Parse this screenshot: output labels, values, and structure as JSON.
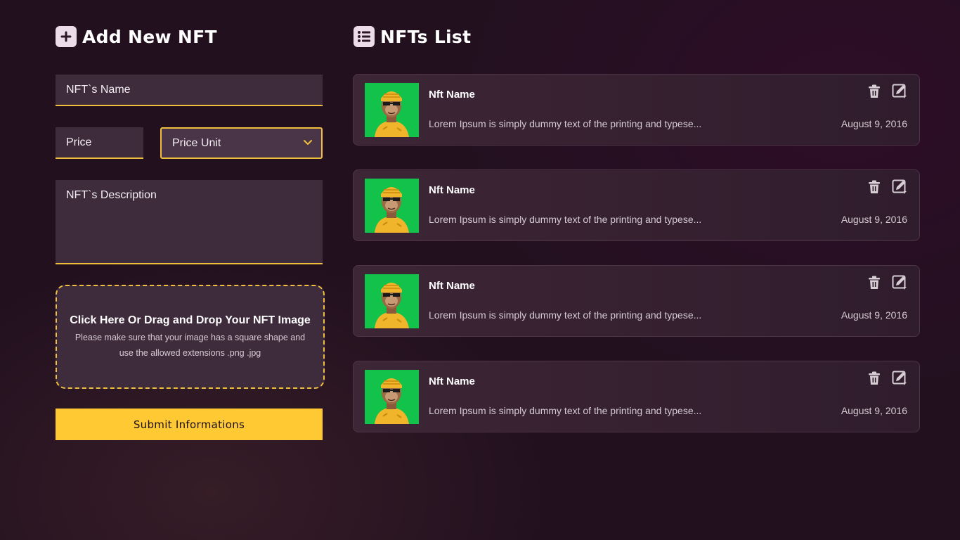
{
  "add_section": {
    "title": "Add New NFT",
    "icon": "plus-icon",
    "name_placeholder": "NFT`s Name",
    "price_placeholder": "Price",
    "price_unit_label": "Price Unit",
    "description_placeholder": "NFT`s Description",
    "dropzone_title": "Click Here Or Drag and Drop Your NFT Image",
    "dropzone_hint_line1": "Please make sure that your image has a square shape and",
    "dropzone_hint_line2": "use the allowed extensions .png .jpg",
    "submit_label": "Submit Informations"
  },
  "list_section": {
    "title": "NFTs List",
    "icon": "list-icon",
    "items": [
      {
        "name": "Nft Name",
        "description": "Lorem Ipsum is simply dummy text of the printing and typese...",
        "date": "August 9, 2016"
      },
      {
        "name": "Nft Name",
        "description": "Lorem Ipsum is simply dummy text of the printing and typese...",
        "date": "August 9, 2016"
      },
      {
        "name": "Nft Name",
        "description": "Lorem Ipsum is simply dummy text of the printing and typese...",
        "date": "August 9, 2016"
      },
      {
        "name": "Nft Name",
        "description": "Lorem Ipsum is simply dummy text of the printing and typese...",
        "date": "August 9, 2016"
      }
    ]
  },
  "colors": {
    "accent": "#f2bf3c",
    "button": "#ffc933",
    "background": "#22101f",
    "field": "#3e2b3c",
    "thumb_bg": "#12c24a"
  }
}
